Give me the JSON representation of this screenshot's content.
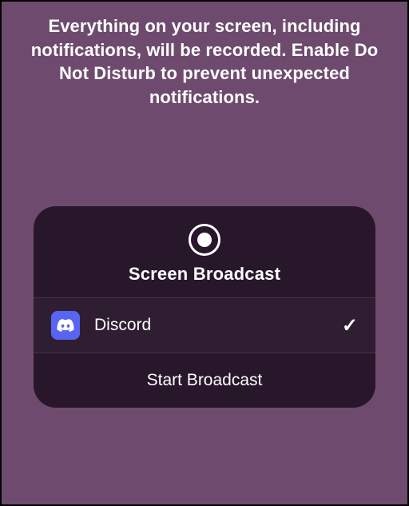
{
  "warning": {
    "text": "Everything on your screen, including notifications, will be recorded. Enable Do Not Disturb to prevent unexpected notifications."
  },
  "card": {
    "title": "Screen Broadcast",
    "selected_app": {
      "name": "Discord",
      "icon": "discord-icon",
      "selected": true
    },
    "start_label": "Start Broadcast"
  }
}
